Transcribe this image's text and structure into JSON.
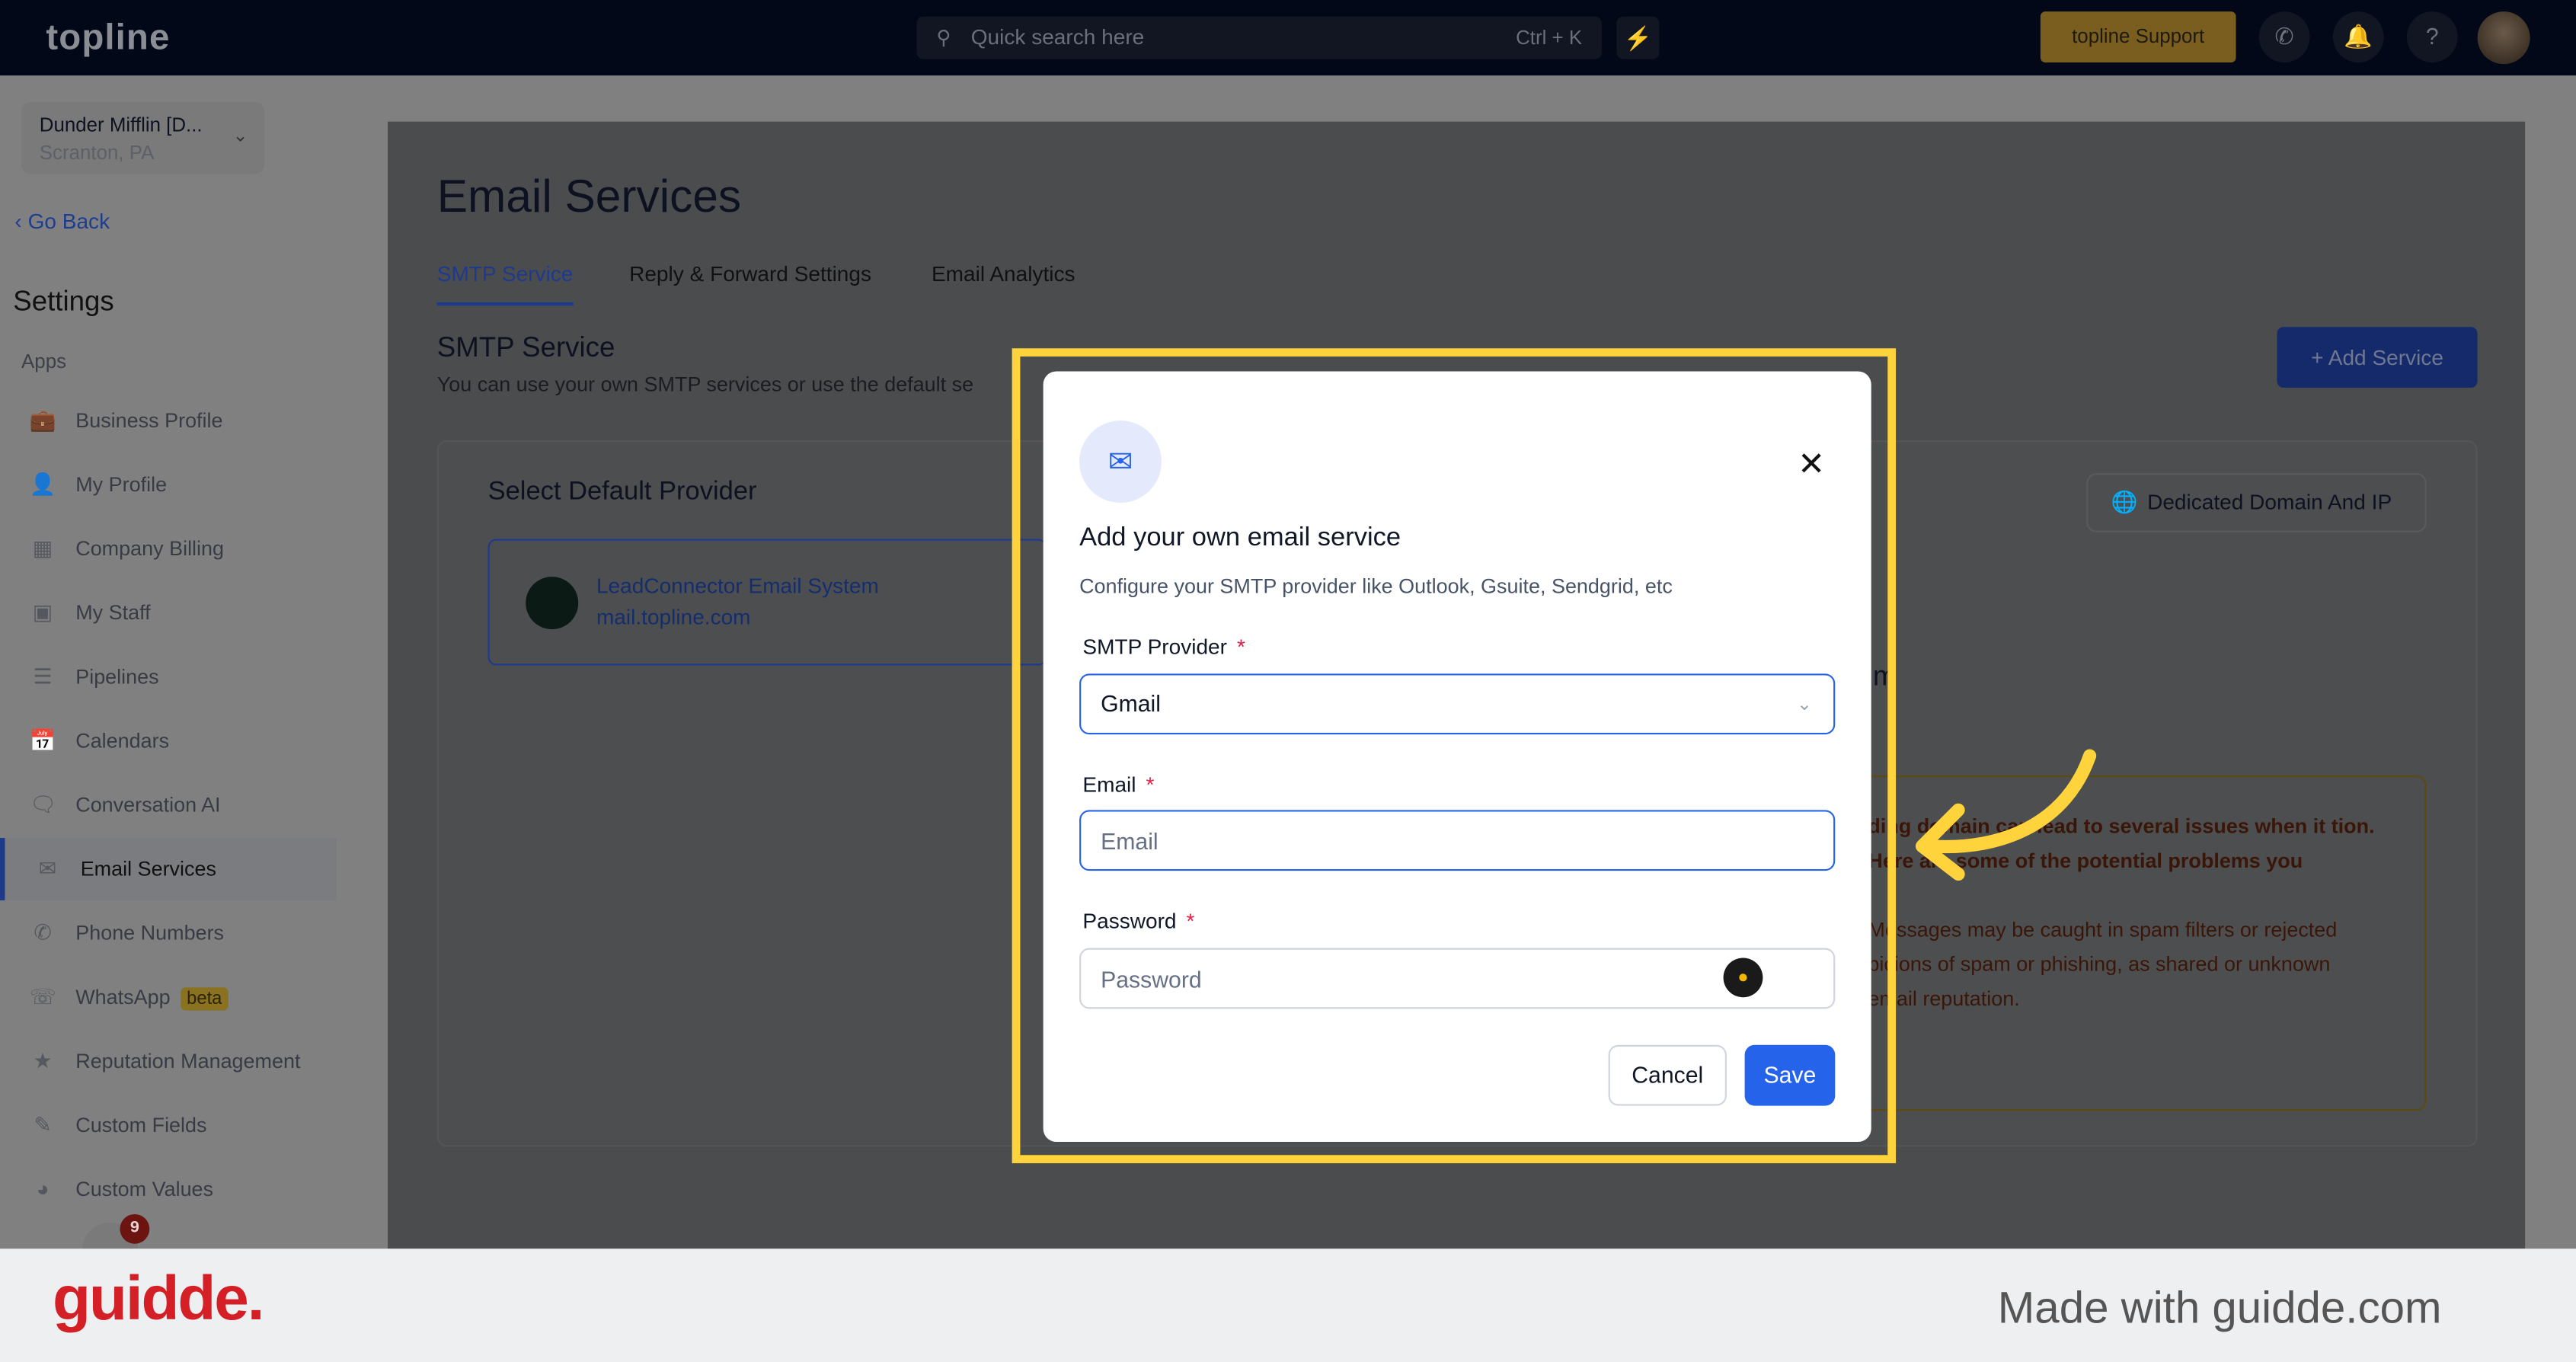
{
  "topbar": {
    "logo": "topline",
    "search_placeholder": "Quick search here",
    "search_shortcut": "Ctrl + K",
    "support_label": "topline Support"
  },
  "account": {
    "name": "Dunder Mifflin [D...",
    "location": "Scranton, PA"
  },
  "sidebar": {
    "go_back": "Go Back",
    "title": "Settings",
    "section": "Apps",
    "items": [
      {
        "label": "Business Profile",
        "icon": "briefcase-icon"
      },
      {
        "label": "My Profile",
        "icon": "user-icon"
      },
      {
        "label": "Company Billing",
        "icon": "grid-icon"
      },
      {
        "label": "My Staff",
        "icon": "staff-icon"
      },
      {
        "label": "Pipelines",
        "icon": "pipeline-icon"
      },
      {
        "label": "Calendars",
        "icon": "calendar-icon"
      },
      {
        "label": "Conversation AI",
        "icon": "chat-icon"
      },
      {
        "label": "Email Services",
        "icon": "mail-icon",
        "active": true
      },
      {
        "label": "Phone Numbers",
        "icon": "phone-icon"
      },
      {
        "label": "WhatsApp",
        "icon": "whatsapp-icon",
        "badge": "beta"
      },
      {
        "label": "Reputation Management",
        "icon": "star-icon"
      },
      {
        "label": "Custom Fields",
        "icon": "edit-icon"
      },
      {
        "label": "Custom Values",
        "icon": "pie-icon"
      }
    ],
    "notification_count": "9"
  },
  "main": {
    "title": "Email Services",
    "tabs": [
      "SMTP Service",
      "Reply & Forward Settings",
      "Email Analytics"
    ],
    "section_title": "SMTP Service",
    "section_desc": "You can use your own SMTP services or use the default se",
    "add_service": "Add Service",
    "select_provider": "Select Default Provider",
    "provider_name": "LeadConnector Email System",
    "provider_domain": "mail.topline.com",
    "dedicated": "Dedicated Domain And IP",
    "partial_heading": "m",
    "warning_bold": "ding domain can lead to several issues when it tion. Here are some of the potential problems you",
    "warning_text": "Messages may be caught in spam filters or rejected picions of spam or phishing, as shared or unknown email reputation."
  },
  "modal": {
    "title": "Add your own email service",
    "description": "Configure your SMTP provider like Outlook, Gsuite, Sendgrid, etc",
    "provider_label": "SMTP Provider",
    "provider_value": "Gmail",
    "email_label": "Email",
    "email_placeholder": "Email",
    "password_label": "Password",
    "password_placeholder": "Password",
    "required": "*",
    "cancel": "Cancel",
    "save": "Save"
  },
  "footer": {
    "brand": "guidde.",
    "made_with": "Made with guidde.com"
  },
  "colors": {
    "highlight": "#ffd33c",
    "primary": "#2563eb",
    "brand_red": "#d41f26"
  }
}
